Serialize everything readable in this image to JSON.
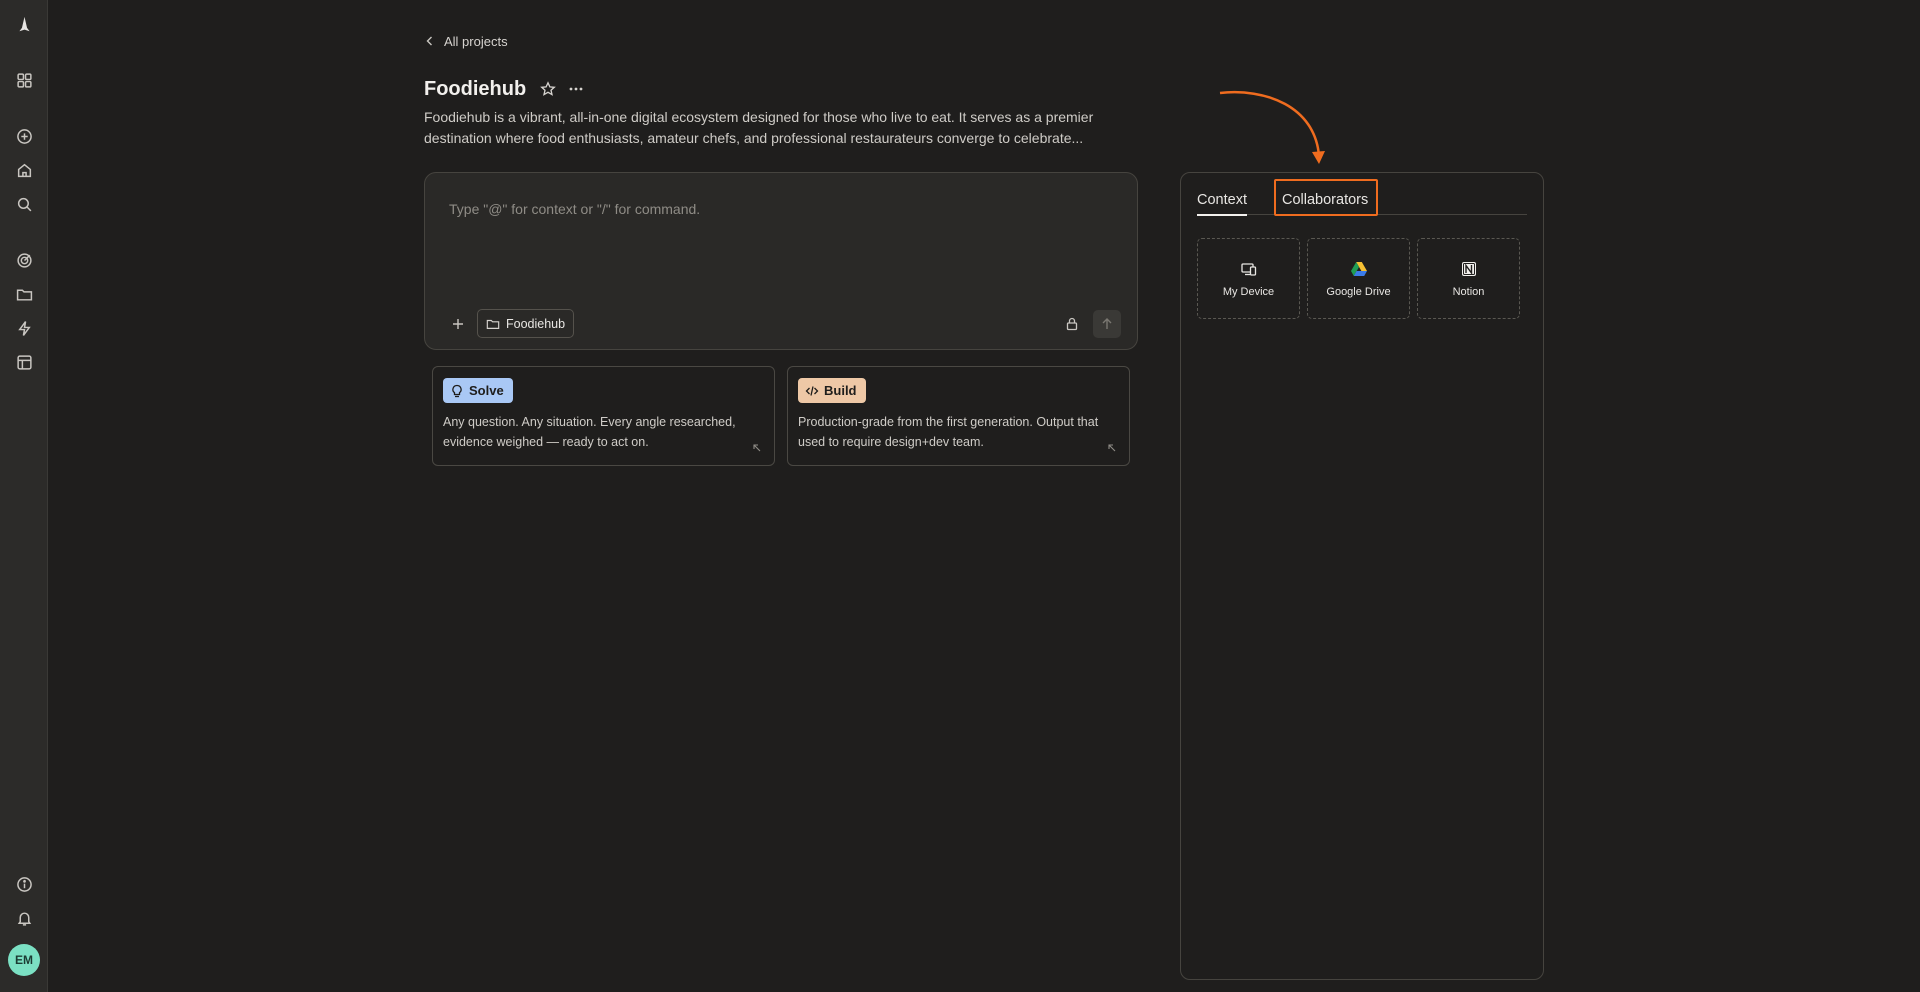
{
  "sidebar": {
    "items": [
      {
        "name": "apps-grid-icon"
      },
      {
        "name": "new-chat-icon"
      },
      {
        "name": "home-icon"
      },
      {
        "name": "search-icon"
      },
      {
        "name": "target-icon"
      },
      {
        "name": "folder-icon"
      },
      {
        "name": "lightning-icon"
      },
      {
        "name": "layout-icon"
      },
      {
        "name": "info-icon"
      },
      {
        "name": "bell-icon"
      }
    ],
    "avatar_initials": "EM"
  },
  "header": {
    "back_label": "All projects",
    "title": "Foodiehub",
    "description": "Foodiehub is a vibrant, all-in-one digital ecosystem designed for those who live to eat. It serves as a premier destination where food enthusiasts, amateur chefs, and professional restaurateurs converge to celebrate..."
  },
  "composer": {
    "placeholder": "Type \"@\" for context or \"/\" for command.",
    "folder_chip": "Foodiehub"
  },
  "modes": [
    {
      "label": "Solve",
      "description": "Any question. Any situation. Every angle researched, evidence weighed — ready to act on.",
      "color": "#a9c8f5"
    },
    {
      "label": "Build",
      "description": "Production-grade from the first generation. Output that used to require design+dev team.",
      "color": "#eec8a6"
    }
  ],
  "panel": {
    "tabs": [
      {
        "label": "Context",
        "active": true
      },
      {
        "label": "Collaborators",
        "active": false
      }
    ],
    "sources": [
      {
        "label": "My Device",
        "icon": "device-icon"
      },
      {
        "label": "Google Drive",
        "icon": "google-drive-icon"
      },
      {
        "label": "Notion",
        "icon": "notion-icon"
      }
    ]
  },
  "colors": {
    "highlight": "#ef6c1f",
    "avatar": "#7be0c3"
  }
}
